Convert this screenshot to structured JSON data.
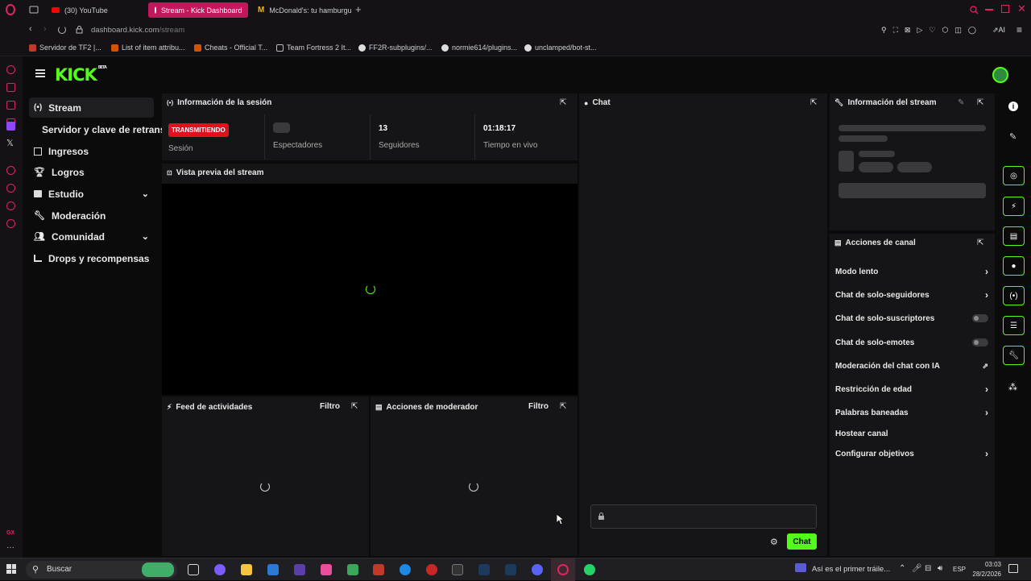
{
  "browser": {
    "tabs": [
      "(30) YouTube",
      "Stream - Kick Dashboard",
      "McDonald's: tu hamburgue"
    ],
    "url_host": "dashboard.kick.com",
    "url_path": "/stream",
    "ai_label": "AI",
    "bookmarks": [
      "Servidor de TF2 |...",
      "List of item attribu...",
      "Cheats - Official T...",
      "Team Fortress 2 It...",
      "FF2R-subplugins/...",
      "normie614/plugins...",
      "unclamped/bot-st..."
    ]
  },
  "kick": {
    "logo": "KICK",
    "logo_sup": "BETA",
    "sidebar": [
      {
        "label": "Stream",
        "icon": "broadcast-icon"
      },
      {
        "label": "Servidor y clave de retransm",
        "icon": ""
      },
      {
        "label": "Ingresos",
        "icon": "chart-icon"
      },
      {
        "label": "Logros",
        "icon": "trophy-icon"
      },
      {
        "label": "Estudio",
        "icon": "studio-icon"
      },
      {
        "label": "Moderación",
        "icon": "wrench-icon"
      },
      {
        "label": "Comunidad",
        "icon": "users-icon"
      },
      {
        "label": "Drops y recompensas",
        "icon": "drops-icon"
      }
    ],
    "session": {
      "title": "Información de la sesión",
      "status_badge": "TRANSMITIENDO",
      "session_label": "Sesión",
      "viewers_label": "Espectadores",
      "followers_value": "13",
      "followers_label": "Seguidores",
      "live_time_value": "01:18:17",
      "live_time_label": "Tiempo en vivo"
    },
    "preview_title": "Vista previa del stream",
    "activity_title": "Feed de actividades",
    "moderator_title": "Acciones de moderador",
    "filter_label": "Filtro",
    "chat": {
      "title": "Chat",
      "send_label": "Chat"
    },
    "stream_info_title": "Información del stream",
    "channel_actions": {
      "title": "Acciones de canal",
      "items": [
        {
          "label": "Modo lento",
          "type": "chevron"
        },
        {
          "label": "Chat de solo-seguidores",
          "type": "chevron"
        },
        {
          "label": "Chat de solo-suscriptores",
          "type": "toggle"
        },
        {
          "label": "Chat de solo-emotes",
          "type": "toggle"
        },
        {
          "label": "Moderación del chat con IA",
          "type": "external"
        },
        {
          "label": "Restricción de edad",
          "type": "chevron"
        },
        {
          "label": "Palabras baneadas",
          "type": "chevron"
        },
        {
          "label": "Hostear canal",
          "type": "none"
        },
        {
          "label": "Configurar objetivos",
          "type": "chevron"
        }
      ]
    }
  },
  "taskbar": {
    "search": "Buscar",
    "notification": "Así es el primer tráile...",
    "lang": "ESP",
    "time": "03:03",
    "date": "28/2/2026"
  },
  "colors": {
    "kick_green": "#53fc18",
    "live_red": "#e0101e",
    "tab_active": "#c2185b"
  }
}
